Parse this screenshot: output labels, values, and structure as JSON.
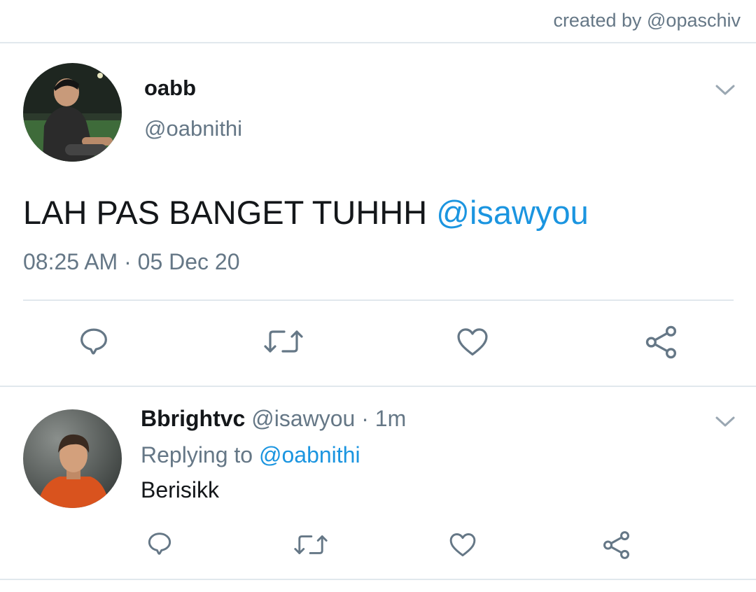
{
  "credit": "created by @opaschiv",
  "main_tweet": {
    "display_name": "oabb",
    "handle": "@oabnithi",
    "text": "LAH PAS BANGET TUHHH",
    "mention": "@isawyou",
    "time": "08:25 AM",
    "separator": "·",
    "date": "05 Dec 20"
  },
  "reply_tweet": {
    "display_name": "Bbrightvc",
    "handle": "@isawyou",
    "separator": "·",
    "age": "1m",
    "replying_label": "Replying to",
    "replying_handle": "@oabnithi",
    "text": "Berisikk"
  },
  "icons": {
    "reply": "reply-icon",
    "retweet": "retweet-icon",
    "like": "heart-icon",
    "share": "share-icon",
    "menu": "chevron-down-icon"
  },
  "colors": {
    "text": "#14171a",
    "secondary": "#657786",
    "link": "#1b95e0",
    "icon": "#657786",
    "divider": "#e1e8ed"
  }
}
